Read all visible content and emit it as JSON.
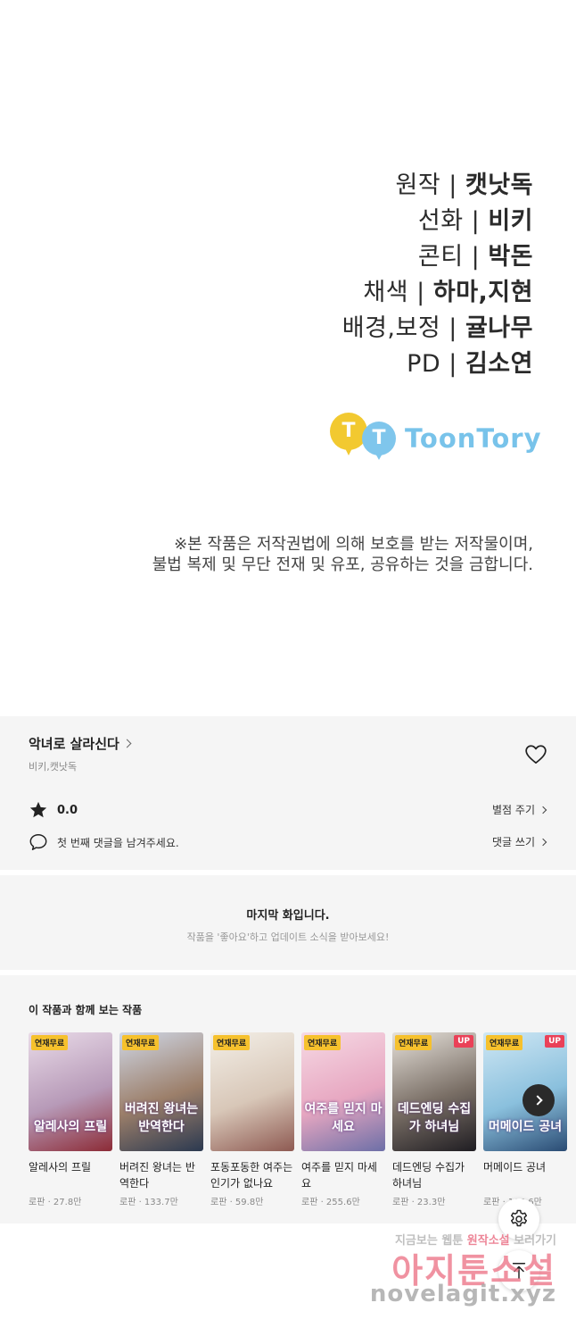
{
  "credits": {
    "lines": [
      {
        "role": "원작 | ",
        "name": "캣낫독"
      },
      {
        "role": "선화 | ",
        "name": "비키"
      },
      {
        "role": "콘티 | ",
        "name": "박돈"
      },
      {
        "role": "채색 | ",
        "name": "하마,지현"
      },
      {
        "role": "배경,보정 | ",
        "name": "귤나무"
      },
      {
        "role": "PD | ",
        "name": "김소연"
      }
    ],
    "logo_letter_1": "T",
    "logo_letter_2": "T",
    "logo_text": "ToonTory",
    "notice_line_1": "※본 작품은 저작권법에 의해 보호를 받는 저작물이며,",
    "notice_line_2": "불법 복제 및 무단 전재 및 유포, 공유하는 것을 금합니다."
  },
  "work": {
    "title": "악녀로 살라신다",
    "authors": "비키,캣낫독",
    "rating": "0.0",
    "rate_link": "별점 주기",
    "comment_prompt": "첫 번째 댓글을 남겨주세요.",
    "comment_link": "댓글 쓰기"
  },
  "last_episode": {
    "title": "마지막 화입니다.",
    "subtitle": "작품을 '좋아요'하고 업데이트 소식을 받아보세요!"
  },
  "recommendations": {
    "heading": "이 작품과 함께 보는 작품",
    "items": [
      {
        "badge": "연재무료",
        "up": "",
        "cover_text": "알레사의 프릴",
        "title": "알레사의 프릴",
        "meta": "로판 · 27.8만",
        "colors": [
          "#e9dbe8",
          "#b79ab8",
          "#8c2b36"
        ]
      },
      {
        "badge": "연재무료",
        "up": "",
        "cover_text": "버려진 왕녀는 반역한다",
        "title": "버려진 왕녀는 반역한다",
        "meta": "로판 · 133.7만",
        "colors": [
          "#cfd7e6",
          "#9c7f6a",
          "#2b3950"
        ]
      },
      {
        "badge": "연재무료",
        "up": "",
        "cover_text": "",
        "title": "포동포동한 여주는 인기가 없나요",
        "meta": "로판 · 59.8만",
        "colors": [
          "#f3efe7",
          "#d8c7b8",
          "#8e5a52"
        ]
      },
      {
        "badge": "연재무료",
        "up": "",
        "cover_text": "여주를 믿지 마세요",
        "title": "여주를 믿지 마세요",
        "meta": "로판 · 255.6만",
        "colors": [
          "#f6d9e4",
          "#e7a7c1",
          "#6d6fa7"
        ]
      },
      {
        "badge": "연재무료",
        "up": "UP",
        "cover_text": "데드엔딩 수집가 하녀님",
        "title": "데드엔딩 수집가 하녀님",
        "meta": "로판 · 23.3만",
        "colors": [
          "#e6e1da",
          "#7a6f66",
          "#1f1d22"
        ]
      },
      {
        "badge": "연재무료",
        "up": "UP",
        "cover_text": "머메이드 공녀",
        "title": "머메이드 공녀",
        "meta": "로판 · 106.6만",
        "colors": [
          "#cfe7f4",
          "#8ac0dd",
          "#2a4b73"
        ]
      }
    ]
  },
  "watermark": {
    "line1_a": "지금보는 웹툰 ",
    "line1_b": "원작소설",
    "line1_c": " 보러가기",
    "line2": "아지툰소설",
    "line3": "novelagit.xyz"
  },
  "icons": {
    "heart": "heart-icon",
    "star": "star-icon",
    "comment": "comment-icon",
    "next": "chevron-right-icon",
    "settings": "gear-icon",
    "scroll_top": "arrow-up-icon"
  }
}
